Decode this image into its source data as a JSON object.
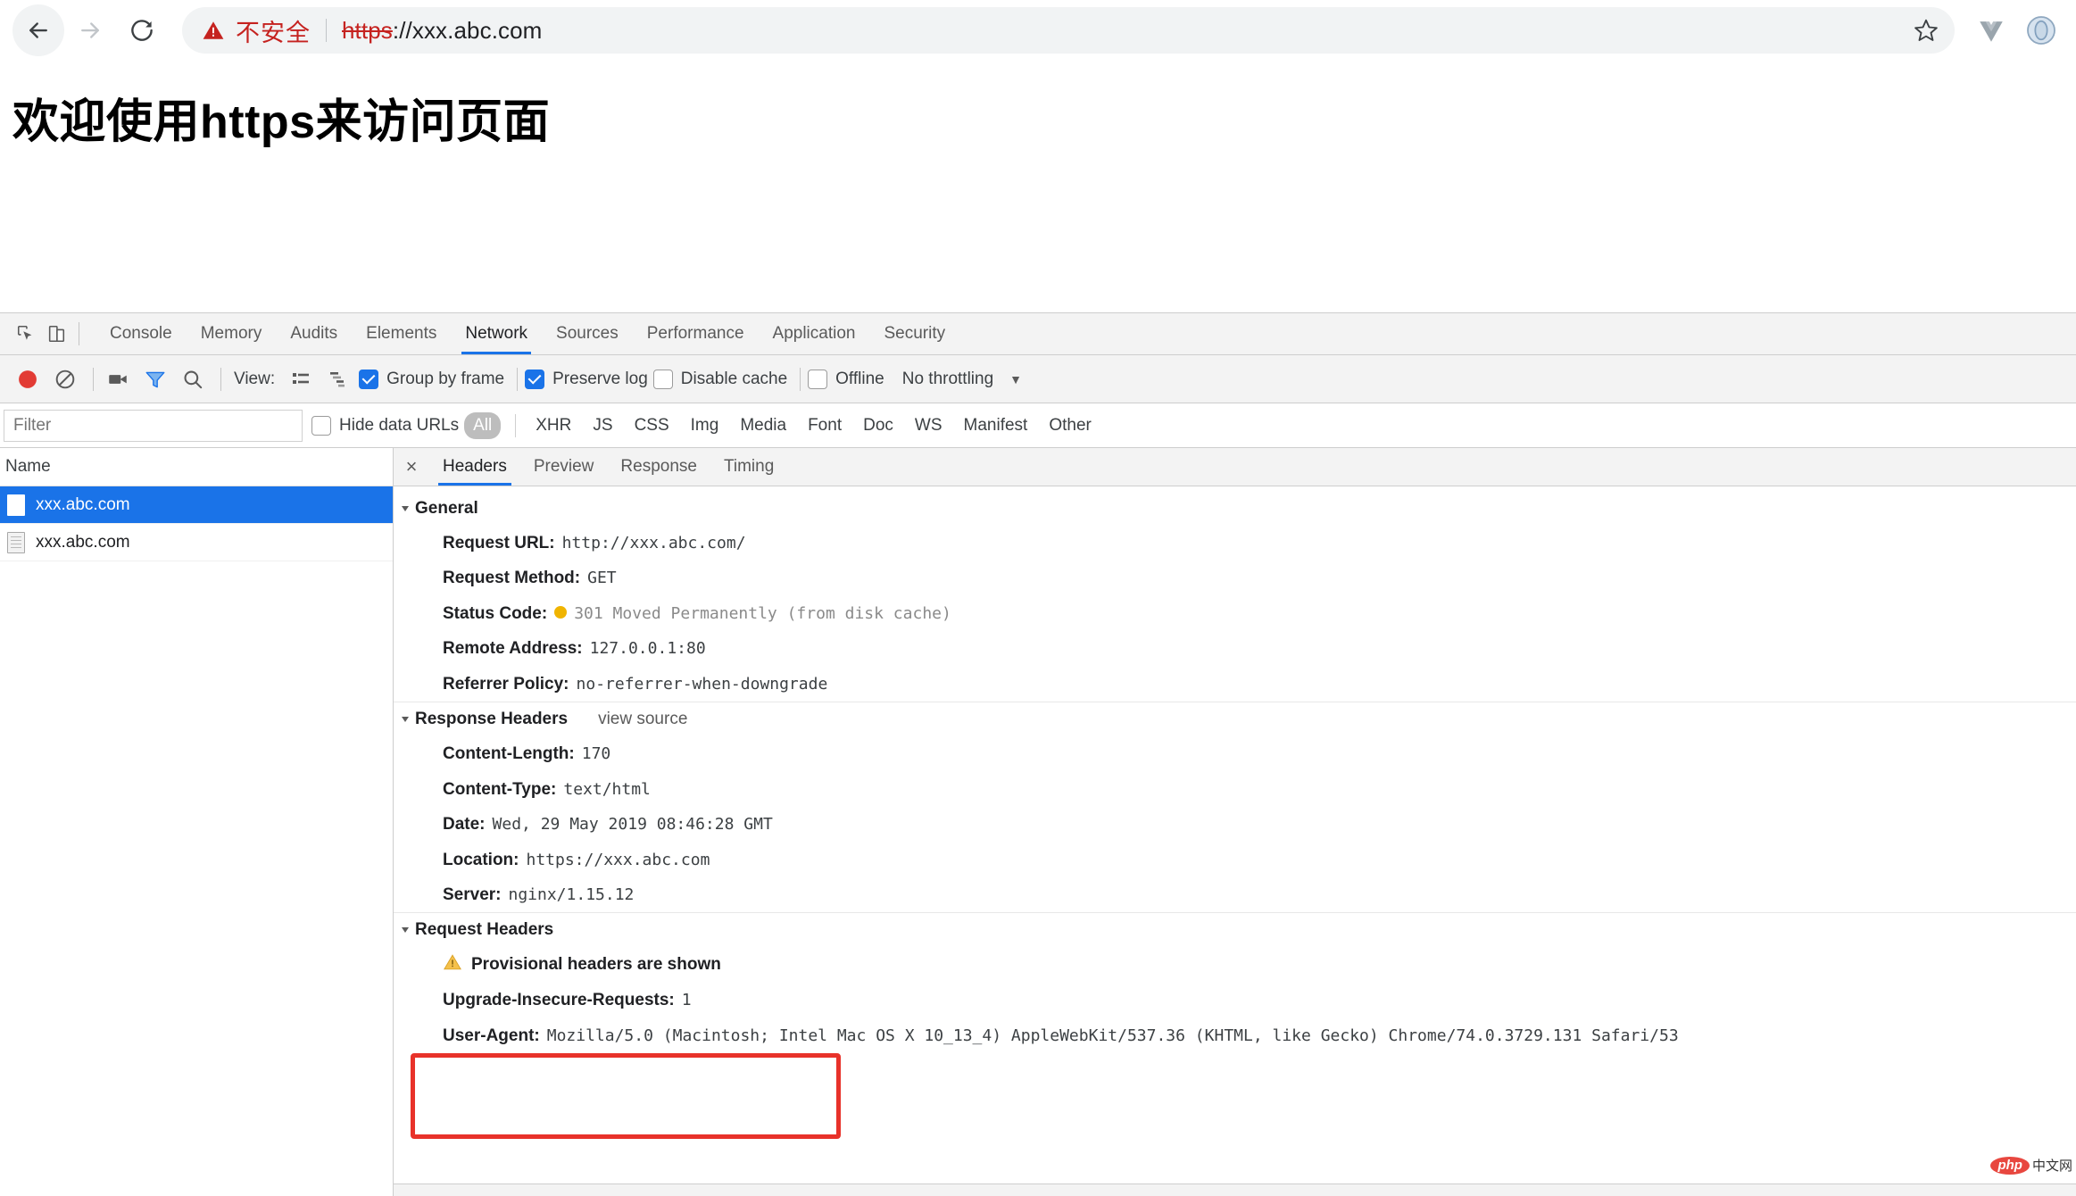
{
  "browser": {
    "back_label": "Back",
    "forward_label": "Forward",
    "reload_label": "Reload",
    "security_warning": "不安全",
    "url_scheme": "https",
    "url_rest": "://xxx.abc.com",
    "bookmark_label": "Bookmark this page",
    "extensions": [
      {
        "name": "vue-devtools-icon",
        "label": "Vue.js devtools"
      },
      {
        "name": "profile-icon",
        "label": "Profile"
      }
    ]
  },
  "page": {
    "heading": "欢迎使用https来访问页面"
  },
  "devtools": {
    "inspect_label": "Inspect element",
    "device_label": "Toggle device toolbar",
    "tabs": [
      {
        "label": "Console",
        "selected": false
      },
      {
        "label": "Memory",
        "selected": false
      },
      {
        "label": "Audits",
        "selected": false
      },
      {
        "label": "Elements",
        "selected": false
      },
      {
        "label": "Network",
        "selected": true
      },
      {
        "label": "Sources",
        "selected": false
      },
      {
        "label": "Performance",
        "selected": false
      },
      {
        "label": "Application",
        "selected": false
      },
      {
        "label": "Security",
        "selected": false
      }
    ],
    "toolbar": {
      "record_label": "Stop recording network log",
      "clear_label": "Clear",
      "screenshot_label": "Capture screenshots",
      "filter_label": "Filter",
      "search_label": "Search",
      "view_label": "View:",
      "list_view_label": "Use large request rows",
      "waterfall_view_label": "Show overview",
      "group_by_frame": {
        "label": "Group by frame",
        "checked": true
      },
      "preserve_log": {
        "label": "Preserve log",
        "checked": true
      },
      "disable_cache": {
        "label": "Disable cache",
        "checked": false
      },
      "offline": {
        "label": "Offline",
        "checked": false
      },
      "throttling": "No throttling",
      "throttling_arrow": "▼"
    },
    "filterbar": {
      "filter_placeholder": "Filter",
      "filter_value": "",
      "hide_data_urls": {
        "label": "Hide data URLs",
        "checked": false
      },
      "types": [
        {
          "label": "All",
          "active": true
        },
        {
          "label": "XHR",
          "active": false
        },
        {
          "label": "JS",
          "active": false
        },
        {
          "label": "CSS",
          "active": false
        },
        {
          "label": "Img",
          "active": false
        },
        {
          "label": "Media",
          "active": false
        },
        {
          "label": "Font",
          "active": false
        },
        {
          "label": "Doc",
          "active": false
        },
        {
          "label": "WS",
          "active": false
        },
        {
          "label": "Manifest",
          "active": false
        },
        {
          "label": "Other",
          "active": false
        }
      ]
    },
    "requests": {
      "column_header": "Name",
      "rows": [
        {
          "name": "xxx.abc.com",
          "selected": true,
          "icon": "document-icon"
        },
        {
          "name": "xxx.abc.com",
          "selected": false,
          "icon": "document-lined-icon"
        }
      ]
    },
    "detail": {
      "close_label": "×",
      "tabs": [
        {
          "label": "Headers",
          "selected": true
        },
        {
          "label": "Preview",
          "selected": false
        },
        {
          "label": "Response",
          "selected": false
        },
        {
          "label": "Timing",
          "selected": false
        }
      ],
      "general": {
        "title": "General",
        "rows": [
          {
            "key": "Request URL:",
            "value": "http://xxx.abc.com/",
            "muted": false,
            "dot": false
          },
          {
            "key": "Request Method:",
            "value": "GET",
            "muted": false,
            "dot": false
          },
          {
            "key": "Status Code:",
            "value": "301 Moved Permanently (from disk cache)",
            "muted": true,
            "dot": true
          },
          {
            "key": "Remote Address:",
            "value": "127.0.0.1:80",
            "muted": false,
            "dot": false
          },
          {
            "key": "Referrer Policy:",
            "value": "no-referrer-when-downgrade",
            "muted": false,
            "dot": false
          }
        ]
      },
      "response_headers": {
        "title": "Response Headers",
        "view_source": "view source",
        "rows": [
          {
            "key": "Content-Length:",
            "value": "170"
          },
          {
            "key": "Content-Type:",
            "value": "text/html"
          },
          {
            "key": "Date:",
            "value": "Wed, 29 May 2019 08:46:28 GMT"
          },
          {
            "key": "Location:",
            "value": "https://xxx.abc.com"
          },
          {
            "key": "Server:",
            "value": "nginx/1.15.12"
          }
        ]
      },
      "request_headers": {
        "title": "Request Headers",
        "provisional_warning": "Provisional headers are shown",
        "rows": [
          {
            "key": "Upgrade-Insecure-Requests:",
            "value": "1"
          },
          {
            "key": "User-Agent:",
            "value": "Mozilla/5.0 (Macintosh; Intel Mac OS X 10_13_4) AppleWebKit/537.36 (KHTML, like Gecko) Chrome/74.0.3729.131 Safari/53"
          }
        ]
      }
    }
  },
  "watermark": {
    "logo": "php",
    "text": "中文网"
  },
  "colors": {
    "accent_blue": "#1a73e8",
    "warning_red": "#c5221f",
    "annotation_red": "#e8322a",
    "status_amber": "#f0b400"
  }
}
